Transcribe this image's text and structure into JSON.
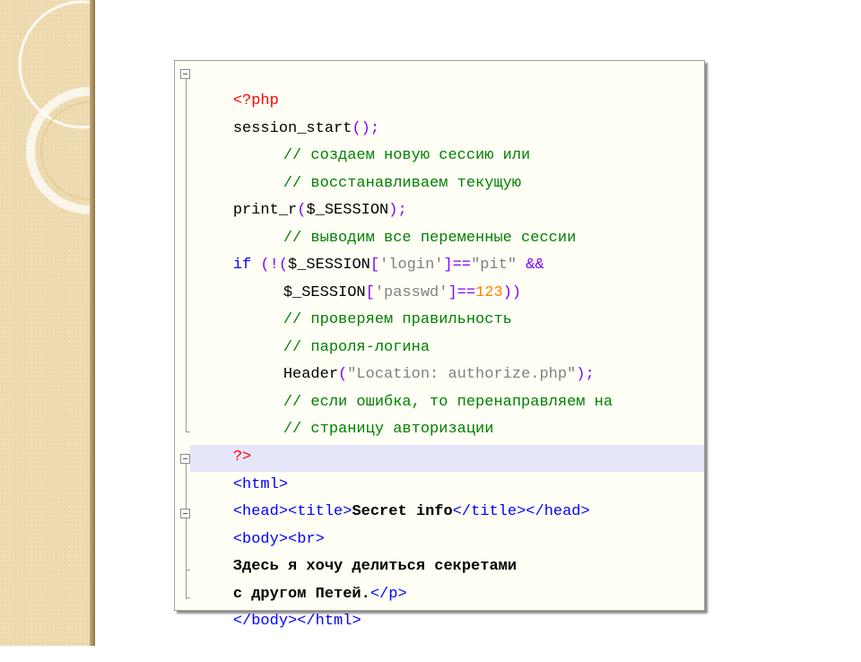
{
  "code": {
    "php_open": "<?php",
    "session_start": "session_start",
    "session_start_parens": "();",
    "comment_1": "// создаем новую сессию или",
    "comment_2": "// восстанавливаем текущую",
    "print_r": "print_r",
    "print_r_paren_open": "(",
    "print_r_arg": "$_SESSION",
    "print_r_paren_close": ");",
    "comment_3": "// выводим все переменные сессии",
    "if_kw": "if",
    "if_open": " (!(",
    "session_var_1": "$_SESSION",
    "bracket_open_1": "[",
    "login_key": "'login'",
    "eq_1": "]==",
    "pit_value": "\"pit\"",
    "and_op": " &&",
    "session_var_2": "$_SESSION",
    "bracket_open_2": "[",
    "passwd_key": "'passwd'",
    "eq_2": "]==",
    "num_123": "123",
    "close_parens": "))",
    "comment_4": "// проверяем правильность",
    "comment_5": "// пароля-логина",
    "header_fn": "Header",
    "header_paren_open": "(",
    "header_arg": "\"Location: authorize.php\"",
    "header_paren_close": ");",
    "comment_6": "// если ошибка, то перенаправляем на",
    "comment_7": "// страницу авторизации",
    "php_close": "?>",
    "html_open": "<html>",
    "head_open": "<head>",
    "title_open": "<title>",
    "title_text": "Secret info",
    "title_close": "</title>",
    "head_close": "</head>",
    "body_open": "<body>",
    "br_tag": "<br>",
    "text_1": "Здесь я хочу делиться секретами",
    "text_2": "с другом Петей.",
    "p_close": "</p>",
    "body_close": "</body>",
    "html_close": "</html>"
  },
  "colors": {
    "tag": "#0000ff",
    "php_tag": "#ff0000",
    "comment": "#008000",
    "string": "#808080",
    "number": "#ff8000",
    "operator": "#8000ff",
    "current_line": "#e6e6fa"
  }
}
